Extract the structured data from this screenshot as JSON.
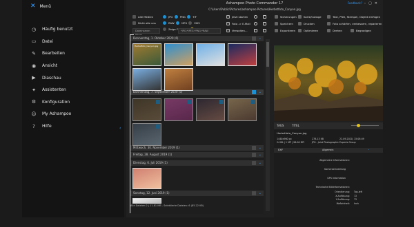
{
  "menu": {
    "title": "Menü",
    "items": [
      {
        "label": "Häufig benutzt",
        "icon": "clock-icon"
      },
      {
        "label": "Datei",
        "icon": "file-icon"
      },
      {
        "label": "Bearbeiten",
        "icon": "pencil-icon"
      },
      {
        "label": "Ansicht",
        "icon": "eye-icon"
      },
      {
        "label": "Diaschau",
        "icon": "play-icon"
      },
      {
        "label": "Assistenten",
        "icon": "wand-icon"
      },
      {
        "label": "Konfiguration",
        "icon": "gear-icon"
      },
      {
        "label": "My Ashampoo",
        "icon": "user-icon"
      },
      {
        "label": "Hilfe",
        "icon": "help-icon"
      }
    ]
  },
  "window": {
    "title": "Ashampoo Photo Commander 17",
    "feedback": "Feedback? ",
    "path": "C:\\Users\\Public\\Pictures\\ashampoo Pictures\\Herbstfoto_Canyon.jpg"
  },
  "toolbar": {
    "all_media": "Alle Medien",
    "not_filter": "Nicht alle uns",
    "jpg": "JPG",
    "png": "PNG",
    "tif": "TIF",
    "raw": "RAW",
    "mp4": "MP4",
    "mkv": "MKV",
    "show_files": "Zeige Farmeldern",
    "show_duplicates": "Zeige Duplikate",
    "send": "Jetzt starten",
    "mail": "Foto -> E-Mail",
    "manage": "Verwalten...",
    "save": "Sicherungen",
    "collage": "Karte/Collage",
    "textfx": "Text, Pfeil, Stempel, Objekt einfügen",
    "crop": "Foto schärfen, verbessern, reparieren",
    "storage": "Speichern",
    "print": "Drucken",
    "export": "Exportieren",
    "optimize": "Optimieren",
    "transform": "Drehen",
    "crop2": "Begradigen",
    "search_placeholder": "Dateinamen filtern...",
    "filter_placeholder": "*JPG;*JPEG;*PNG;*RAW"
  },
  "groups": [
    {
      "label": "Donnerstag, 1. Oktober 2020 (6)",
      "checked": false
    },
    {
      "label": "Donnerstag, 7. September 2020 (5)",
      "checked": true
    },
    {
      "label": "Mittwoch, 30. November 2019 (1)",
      "checked": false
    },
    {
      "label": "Freitag, 28. August 2019 (1)",
      "checked": false
    },
    {
      "label": "Dienstag, 6. Juli 2019 (1)",
      "checked": false
    },
    {
      "label": "Sonntag, 12. Juni 2019 (1)",
      "checked": false
    }
  ],
  "thumbs_g1": [
    {
      "caption": "Herbstfoto_Canyon.jpg",
      "c1": "#a07a30",
      "c2": "#3a5a3a"
    },
    {
      "caption": "",
      "c1": "#2e8fd0",
      "c2": "#d0a060"
    },
    {
      "caption": "",
      "c1": "#6fb0e8",
      "c2": "#e0e0e0"
    },
    {
      "caption": "",
      "c1": "#1a2a60",
      "c2": "#c04040"
    },
    {
      "caption": "",
      "c1": "#7aaee0",
      "c2": "#333"
    },
    {
      "caption": "",
      "c1": "#c08040",
      "c2": "#704020"
    }
  ],
  "thumbs_g2": [
    {
      "caption": "",
      "c1": "#5a4a30",
      "c2": "#8a7050"
    },
    {
      "caption": "",
      "c1": "#c050a0",
      "c2": "#8a3070"
    },
    {
      "caption": "",
      "c1": "#3a3040",
      "c2": "#a07060"
    },
    {
      "caption": "",
      "c1": "#c0a070",
      "c2": "#705040"
    },
    {
      "caption": "",
      "c1": "#4a5a6a",
      "c2": "#8aa0b0"
    }
  ],
  "status": "Alle Dateien:2 | 11.81 MB - Selektierte Dateien: 6 (85.22 KB)",
  "preview": {
    "tabs": [
      "TAGS",
      "TITEL"
    ],
    "file": "Herbstfoto_Canyon.jpg",
    "dims": "1440x960 px",
    "size": "278.13 KB",
    "date": "22.09.2020, 15:08:49",
    "bits": "24 Bit | 1 MP | 96.00 DPI",
    "fmt": "JPG - Joint Photographic Experts Group",
    "exif": "EXIF",
    "general": "Allgemein",
    "sections": [
      "Allgemeine Informationen:",
      "Kameraeinstellung",
      "GPS Information",
      "Technische Bildinformationen:"
    ],
    "tech": [
      {
        "k": "Orientierung:",
        "v": "Top-left"
      },
      {
        "k": "X-Auflösung:",
        "v": "72"
      },
      {
        "k": "Y-Auflösung:",
        "v": "72"
      },
      {
        "k": "Maßeinheit:",
        "v": "Inch"
      }
    ]
  },
  "colors": {
    "accent": "#1e8fd0",
    "bar": "#303030"
  }
}
